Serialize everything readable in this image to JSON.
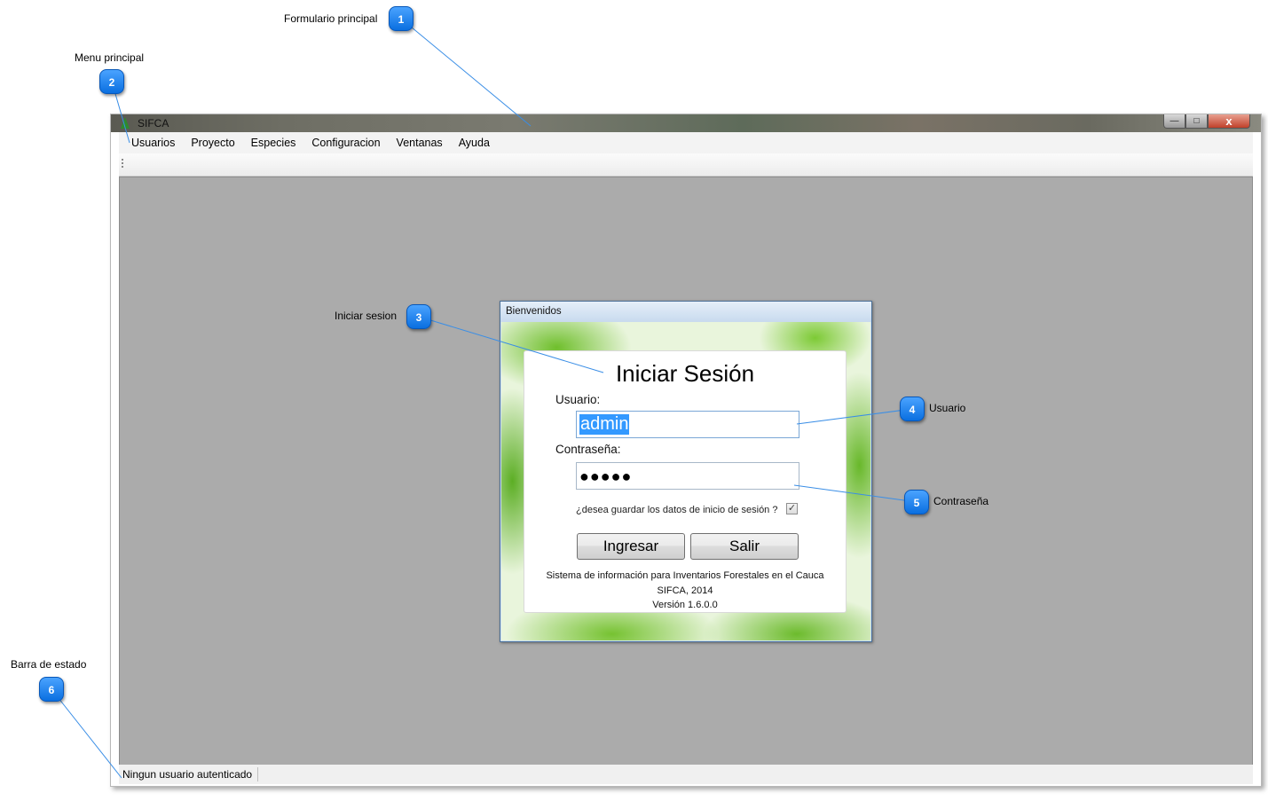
{
  "window": {
    "title": "SIFCA",
    "buttons": {
      "minimize": "—",
      "maximize": "□",
      "close": "x"
    }
  },
  "menu": [
    {
      "label": "Usuarios"
    },
    {
      "label": "Proyecto"
    },
    {
      "label": "Especies"
    },
    {
      "label": "Configuracion"
    },
    {
      "label": "Ventanas"
    },
    {
      "label": "Ayuda"
    }
  ],
  "status": {
    "text": "Ningun usuario autenticado"
  },
  "dialog": {
    "title": "Bienvenidos",
    "heading": "Iniciar Sesión",
    "user_label": "Usuario:",
    "user_value": "admin",
    "password_label": "Contraseña:",
    "password_mask": "●●●●●",
    "remember_label": "¿desea guardar los datos de inicio de sesión ?",
    "remember_checked": true,
    "login_button": "Ingresar",
    "exit_button": "Salir",
    "info_line1": "Sistema de información para Inventarios Forestales en el Cauca",
    "info_line2": "SIFCA, 2014",
    "info_line3": "Versión 1.6.0.0"
  },
  "callouts": [
    {
      "number": "1",
      "label": "Formulario principal"
    },
    {
      "number": "2",
      "label": "Menu principal"
    },
    {
      "number": "3",
      "label": "Iniciar sesion"
    },
    {
      "number": "4",
      "label": "Usuario"
    },
    {
      "number": "5",
      "label": "Contraseña"
    },
    {
      "number": "6",
      "label": "Barra de estado"
    }
  ],
  "colors": {
    "callout_blue": "#1a82f0",
    "mdi_background": "#ababab",
    "selection": "#3399ff"
  }
}
